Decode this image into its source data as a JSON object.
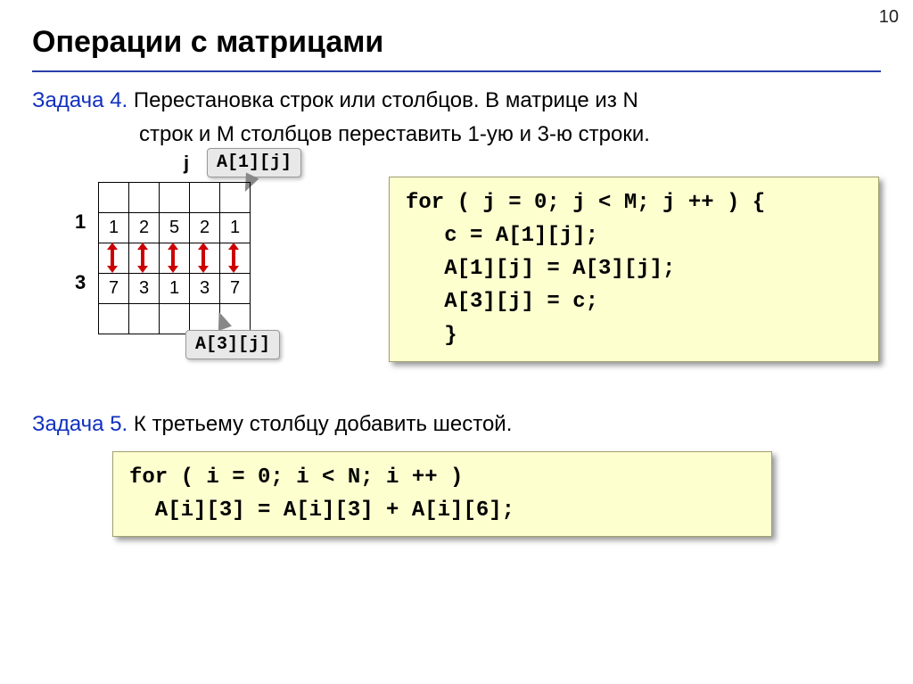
{
  "page_number": "10",
  "title": "Операции с матрицами",
  "task4": {
    "label": "Задача 4.",
    "line1": " Перестановка строк или столбцов. В матрице из N",
    "line2": "строк и M столбцов переставить 1-ую и 3-ю строки."
  },
  "matrix": {
    "j_label": "j",
    "row_labels": {
      "r1": "1",
      "r3": "3"
    },
    "callout_top": "A[1][j]",
    "callout_bot": "A[3][j]",
    "row1": [
      "1",
      "2",
      "5",
      "2",
      "1"
    ],
    "row3": [
      "7",
      "3",
      "1",
      "3",
      "7"
    ]
  },
  "code1": "for ( j = 0; j < M; j ++ ) {\n   c = A[1][j];\n   A[1][j] = A[3][j];\n   A[3][j] = c;\n   }",
  "task5": {
    "label": "Задача 5.",
    "text": " К третьему столбцу добавить шестой."
  },
  "code2": "for ( i = 0; i < N; i ++ )\n  A[i][3] = A[i][3] + A[i][6];"
}
